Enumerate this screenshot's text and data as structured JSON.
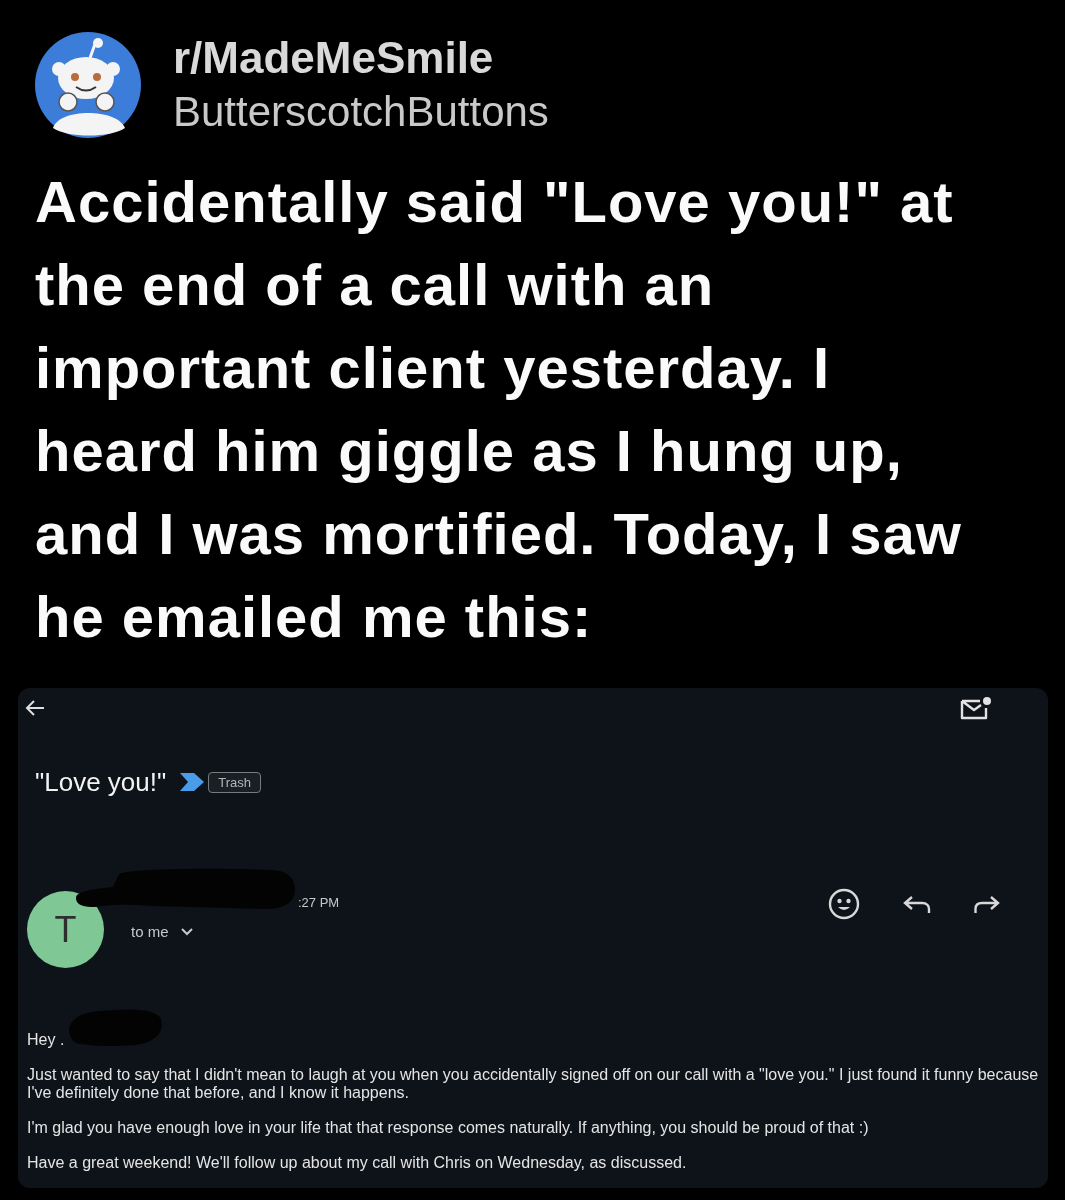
{
  "post": {
    "subreddit": "r/MadeMeSmile",
    "username": "ButterscotchButtons",
    "title": "Accidentally said \"Love you!\" at the end of a call with an important client yesterday. I heard him giggle as I hung up, and I was mortified. Today, I saw he emailed me this:"
  },
  "email": {
    "subject": "\"Love you!\"",
    "important": true,
    "labels": [
      "Trash"
    ],
    "sender": {
      "initial": "T",
      "time": ":27 PM",
      "recipient": "to me"
    },
    "body": [
      "Hey .",
      "Just wanted to say that I didn't mean to laugh at you when you accidentally signed off on our call with a \"love you.\" I just found it funny because I've definitely done that before, and I know it happens.",
      "I'm glad you have enough love in your life that that response comes naturally. If anything, you should be proud of that :)",
      "Have a great weekend! We'll follow up about my call with Chris on Wednesday, as discussed."
    ]
  }
}
